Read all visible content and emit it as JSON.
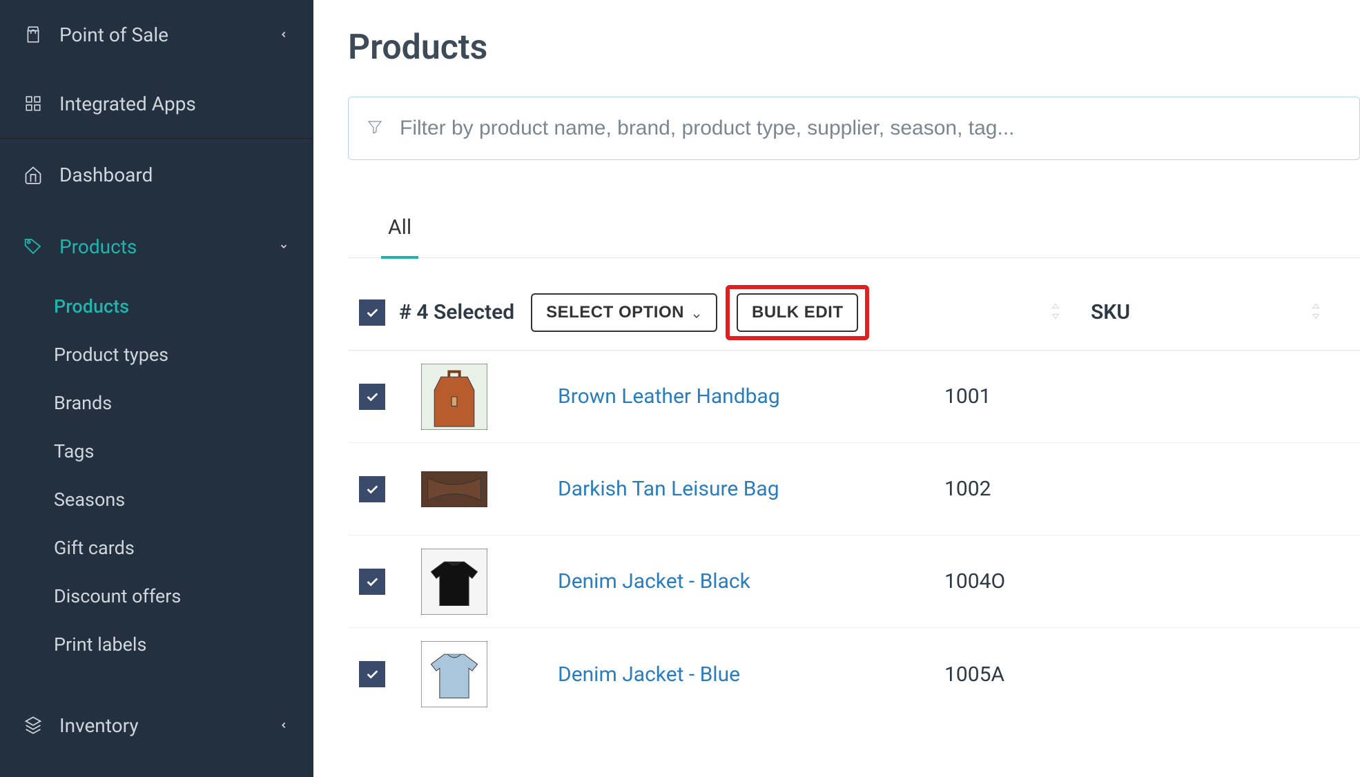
{
  "sidebar": {
    "top": [
      {
        "id": "pos",
        "label": "Point of Sale",
        "hasChevronLeft": true
      },
      {
        "id": "apps",
        "label": "Integrated Apps"
      }
    ],
    "main": [
      {
        "id": "dashboard",
        "label": "Dashboard"
      },
      {
        "id": "products",
        "label": "Products",
        "active": true,
        "expanded": true
      },
      {
        "id": "inventory",
        "label": "Inventory",
        "hasChevronLeft": true
      }
    ],
    "products_sub": [
      {
        "id": "products",
        "label": "Products",
        "active": true
      },
      {
        "id": "product-types",
        "label": "Product types"
      },
      {
        "id": "brands",
        "label": "Brands"
      },
      {
        "id": "tags",
        "label": "Tags"
      },
      {
        "id": "seasons",
        "label": "Seasons"
      },
      {
        "id": "gift-cards",
        "label": "Gift cards"
      },
      {
        "id": "discount-offers",
        "label": "Discount offers"
      },
      {
        "id": "print-labels",
        "label": "Print labels"
      }
    ]
  },
  "page": {
    "title": "Products",
    "filter_placeholder": "Filter by product name, brand, product type, supplier, season, tag...",
    "tab_all": "All",
    "selected_text": "# 4 Selected",
    "select_option_btn": "SELECT OPTION",
    "bulk_edit_btn": "BULK EDIT",
    "sku_header": "SKU"
  },
  "products": [
    {
      "name": "Brown Leather Handbag",
      "sku": "1001",
      "thumb": "handbag-brown"
    },
    {
      "name": "Darkish Tan Leisure Bag",
      "sku": "1002",
      "thumb": "bag-tan"
    },
    {
      "name": "Denim Jacket - Black",
      "sku": "1004O",
      "thumb": "jacket-black"
    },
    {
      "name": "Denim Jacket - Blue",
      "sku": "1005A",
      "thumb": "jacket-blue"
    }
  ]
}
